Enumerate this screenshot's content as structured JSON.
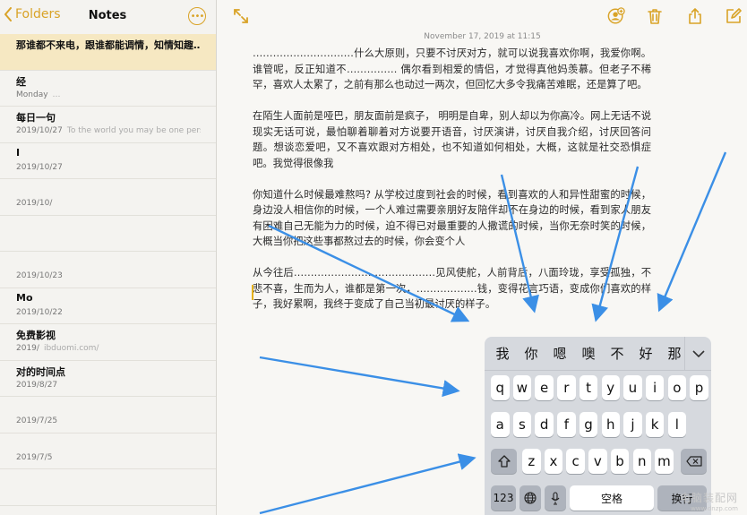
{
  "app": {
    "accent": "#d9a327"
  },
  "sidebar": {
    "back_label": "Folders",
    "title": "Notes",
    "notes": [
      {
        "title": "那谁都不来电，跟谁都能调情，知情知趣…",
        "date": "",
        "preview": "",
        "selected": true
      },
      {
        "title": "经",
        "date": "Monday",
        "preview": "…",
        "selected": false
      },
      {
        "title": "每日一句",
        "date": "2019/10/27",
        "preview": "To the world you may be one pers…",
        "selected": false
      },
      {
        "title": "I",
        "date": "2019/10/27",
        "preview": "",
        "selected": false
      },
      {
        "title": "",
        "date": "2019/10/",
        "preview": "",
        "selected": false
      },
      {
        "title": "",
        "date": "",
        "preview": "",
        "selected": false
      },
      {
        "title": "",
        "date": "2019/10/23",
        "preview": "",
        "selected": false
      },
      {
        "title": "Mo",
        "date": "2019/10/22",
        "preview": "",
        "selected": false
      },
      {
        "title": "免费影视",
        "date": "2019/",
        "preview": "ibduomi.com/",
        "selected": false
      },
      {
        "title": "对的时间点",
        "date": "2019/8/27",
        "preview": "",
        "selected": false
      },
      {
        "title": "",
        "date": "2019/7/25",
        "preview": "",
        "selected": false
      },
      {
        "title": "",
        "date": "2019/7/5",
        "preview": "",
        "selected": false
      },
      {
        "title": "",
        "date": "",
        "preview": "",
        "selected": false
      }
    ]
  },
  "note": {
    "date": "November 17, 2019 at 11:15",
    "paragraphs": [
      "…………………………什么大原则，只要不讨厌对方，就可以说我喜欢你啊，我爱你啊。谁管呢，反正知道不…………… 偶尔看到相爱的情侣，才觉得真他妈羡慕。但老子不稀罕，喜欢人太累了，之前有那么也动过一两次，但回忆大多令我痛苦难眠，还是算了吧。",
      "在陌生人面前是哑巴，朋友面前是疯子， 明明是自卑，别人却以为你高冷。网上无话不说现实无话可说，最怕聊着聊着对方说要开语音，讨厌演讲，讨厌自我介绍，讨厌回答问题。想谈恋爱吧，又不喜欢跟对方相处，也不知道如何相处，大概，这就是社交恐惧症吧。我觉得很像我",
      "你知道什么时候最难熬吗? 从学校过度到社会的时候，看到喜欢的人和异性甜蜜的时候，身边没人相信你的时候，一个人难过需要亲朋好友陪伴却不在身边的时候，看到家人朋友有困难自己无能为力的时候，迫不得已对最重要的人撒谎的时候，当你无奈时笑的时候，大概当你把这些事都熬过去的时候，你会变个人",
      "从今往后……………………………………见风使舵，人前背后，八面玲珑，享受孤独，不悲不喜，生而为人，谁都是第一次，………………钱，变得花言巧语，变成你们喜欢的样子，我好累啊，我终于变成了自己当初最讨厌的样子。"
    ]
  },
  "keyboard": {
    "candidates": [
      "我",
      "你",
      "嗯",
      "噢",
      "不",
      "好",
      "那"
    ],
    "row1": [
      "q",
      "w",
      "e",
      "r",
      "t",
      "y",
      "u",
      "i",
      "o",
      "p"
    ],
    "row2": [
      "a",
      "s",
      "d",
      "f",
      "g",
      "h",
      "j",
      "k",
      "l"
    ],
    "row3": [
      "z",
      "x",
      "c",
      "v",
      "b",
      "n",
      "m"
    ],
    "numbers_label": "123",
    "space_label": "空格",
    "return_label": "换行"
  },
  "watermark": {
    "line1": "电脑装配网",
    "line2": "www.dnzp.com"
  },
  "colors": {
    "arrow": "#3b8fe6",
    "selected_note": "#f6e8c2",
    "keyboard_bg": "#d6d9de"
  }
}
